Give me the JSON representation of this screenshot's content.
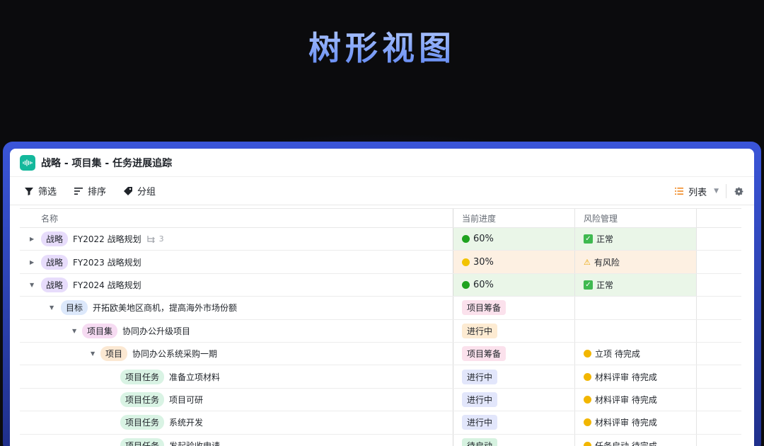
{
  "hero": {
    "title": "树形视图"
  },
  "window": {
    "title": "战略 - 项目集 - 任务进展追踪"
  },
  "toolbar": {
    "filter": "筛选",
    "sort": "排序",
    "group": "分组",
    "view": "列表"
  },
  "columns": {
    "name": "名称",
    "progress": "当前进度",
    "risk": "风险管理"
  },
  "colors": {
    "strategy_tag": "#e7dcfb",
    "goal_tag": "#dce8fb",
    "program_tag": "#f6dbf2",
    "project_tag": "#fbe8d2",
    "task_tag": "#d9f3e4",
    "green_bg": "#eaf6e8",
    "orange_bg": "#fdf0e2"
  },
  "rows": [
    {
      "tag": "战略",
      "name": "FY2022 战略规划",
      "sub_count": "3",
      "progress": "60%",
      "progress_dot": "#1fa31f",
      "risk": "正常",
      "risk_icon": "check-icon"
    },
    {
      "tag": "战略",
      "name": "FY2023 战略规划",
      "progress": "30%",
      "progress_dot": "#f2c300",
      "risk": "有风险",
      "risk_icon": "warning-icon"
    },
    {
      "tag": "战略",
      "name": "FY2024 战略规划",
      "progress": "60%",
      "progress_dot": "#1fa31f",
      "risk": "正常",
      "risk_icon": "check-icon"
    },
    {
      "tag": "目标",
      "name": "开拓欧美地区商机，提高海外市场份额",
      "status": "项目筹备"
    },
    {
      "tag": "项目集",
      "name": "协同办公升级项目",
      "status": "进行中"
    },
    {
      "tag": "项目",
      "name": "协同办公系统采购一期",
      "status": "项目筹备",
      "risk": "立项 待完成"
    },
    {
      "tag": "项目任务",
      "name": "准备立项材料",
      "status": "进行中",
      "risk": "材料评审 待完成"
    },
    {
      "tag": "项目任务",
      "name": "项目可研",
      "status": "进行中",
      "risk": "材料评审 待完成"
    },
    {
      "tag": "项目任务",
      "name": "系统开发",
      "status": "进行中",
      "risk": "材料评审 待完成"
    },
    {
      "tag": "项目任务",
      "name": "发起验收申请",
      "status": "待启动",
      "risk": "任务启动 待完成"
    }
  ]
}
